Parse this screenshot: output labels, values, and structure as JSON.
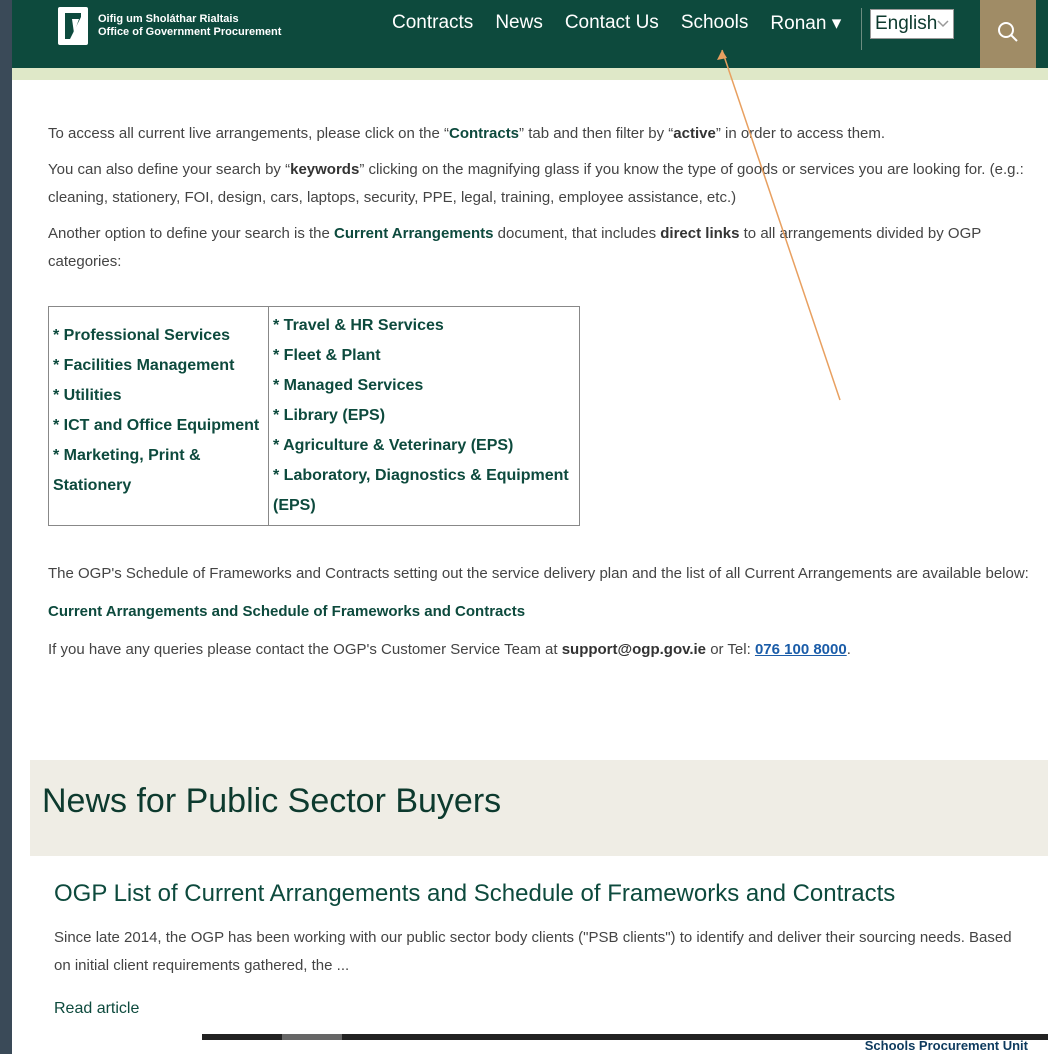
{
  "header": {
    "logo_line1": "Oifig um Sholáthar Rialtais",
    "logo_line2": "Office of Government Procurement",
    "nav": [
      "Contracts",
      "News",
      "Contact Us",
      "Schools",
      "Ronan ▾"
    ],
    "language": "English"
  },
  "content": {
    "p1_a": "To access all current live arrangements, please click on the “",
    "p1_contracts": "Contracts",
    "p1_b": "” tab and then filter by “",
    "p1_active": "active",
    "p1_c": "” in order to access them.",
    "p2_a": "You can also define your search by “",
    "p2_keywords": "keywords",
    "p2_b": "” clicking on the magnifying glass if you know the type of goods or services you are looking for. (e.g.: cleaning, stationery, FOI, design, cars, laptops, security, PPE, legal, training, employee assistance, etc.)",
    "p3_a": "Another option to define your search is the ",
    "p3_current": "Current Arrangements",
    "p3_b": " document, that includes ",
    "p3_direct": "direct links",
    "p3_c": " to all arrangements divided by OGP categories:"
  },
  "categories": {
    "left": [
      "* Professional Services",
      "* Facilities Management",
      "* Utilities",
      "* ICT and Office Equipment",
      "* Marketing, Print & Stationery"
    ],
    "right": [
      "* Travel & HR Services",
      "* Fleet & Plant",
      "* Managed Services",
      "* Library (EPS)",
      "* Agriculture & Veterinary (EPS)",
      "* Laboratory, Diagnostics & Equipment (EPS)"
    ]
  },
  "content2": {
    "p4": "The OGP's Schedule of Frameworks and Contracts setting out the service delivery plan and the list of all Current Arrangements are available below:",
    "link1": "Current Arrangements",
    "link_and": " and ",
    "link2": "Schedule of Frameworks and Contracts",
    "p5_a": "If you have any queries please contact the OGP's Customer Service Team at ",
    "p5_email": "support@ogp.gov.ie",
    "p5_b": " or Tel: ",
    "p5_phone": "076 100 8000",
    "p5_c": "."
  },
  "news": {
    "title": "News for Public Sector Buyers",
    "card_title": "OGP List of Current Arrangements and Schedule of Frameworks and Contracts",
    "card_text": "Since late 2014, the OGP has been working with our public sector body clients (\"PSB clients\") to identify and deliver their sourcing needs. Based on initial client requirements gathered, the ...",
    "card_link": "Read article"
  },
  "footer": {
    "label": "Schools Procurement Unit"
  },
  "colors": {
    "header_bg": "#0d4a3d",
    "accent_green": "#0d4a3d",
    "search_bg": "#a08c66",
    "annotation_arrow": "#e8a060"
  },
  "icons": {
    "logo": "harp-logo-icon",
    "search": "search-icon",
    "language_dropdown": "chevron-down-icon"
  }
}
